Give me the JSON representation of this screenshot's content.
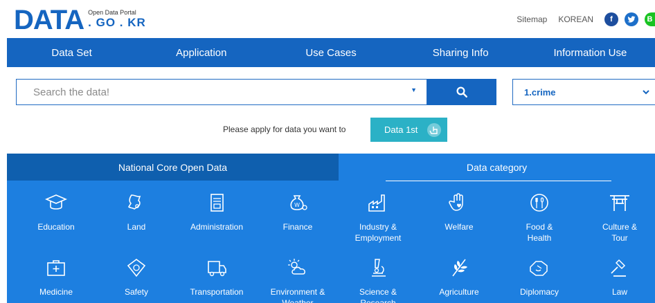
{
  "header": {
    "logo_main": "DATA",
    "logo_small": "Open Data Portal",
    "logo_domain": ". GO . KR",
    "links": [
      "Sitemap",
      "KOREAN"
    ],
    "social": [
      {
        "name": "facebook-icon",
        "glyph": "f"
      },
      {
        "name": "twitter-icon",
        "glyph": "t"
      },
      {
        "name": "blog-icon",
        "glyph": "B"
      }
    ]
  },
  "nav": {
    "items": [
      "Data Set",
      "Application",
      "Use Cases",
      "Sharing Info",
      "Information Use"
    ]
  },
  "search": {
    "placeholder": "Search the data!",
    "select_value": "1.crime"
  },
  "apply": {
    "text": "Please apply for data you want to",
    "button": "Data 1st"
  },
  "panel": {
    "tabs": [
      "National Core Open Data",
      "Data category"
    ],
    "categories": [
      {
        "label": "Education",
        "icon": "graduation-cap-icon"
      },
      {
        "label": "Land",
        "icon": "land-map-icon"
      },
      {
        "label": "Administration",
        "icon": "document-icon"
      },
      {
        "label": "Finance",
        "icon": "money-bag-icon"
      },
      {
        "label": "Industry &\nEmployment",
        "icon": "factory-icon"
      },
      {
        "label": "Welfare",
        "icon": "hand-heart-icon"
      },
      {
        "label": "Food &\nHealth",
        "icon": "fork-spoon-icon"
      },
      {
        "label": "Culture &\nTour",
        "icon": "gate-icon"
      },
      {
        "label": "Medicine",
        "icon": "first-aid-kit-icon"
      },
      {
        "label": "Safety",
        "icon": "shield-face-icon"
      },
      {
        "label": "Transportation",
        "icon": "truck-icon"
      },
      {
        "label": "Environment &\nWeather",
        "icon": "sun-cloud-icon"
      },
      {
        "label": "Science &\nResearch",
        "icon": "microscope-icon"
      },
      {
        "label": "Agriculture",
        "icon": "leaf-icon"
      },
      {
        "label": "Diplomacy",
        "icon": "handshake-icon"
      },
      {
        "label": "Law",
        "icon": "gavel-icon"
      }
    ]
  },
  "colors": {
    "brand_blue": "#1565c0",
    "panel_blue": "#1d7fe0",
    "panel_dark": "#0f5fae",
    "apply_teal": "#2bb1c6"
  }
}
